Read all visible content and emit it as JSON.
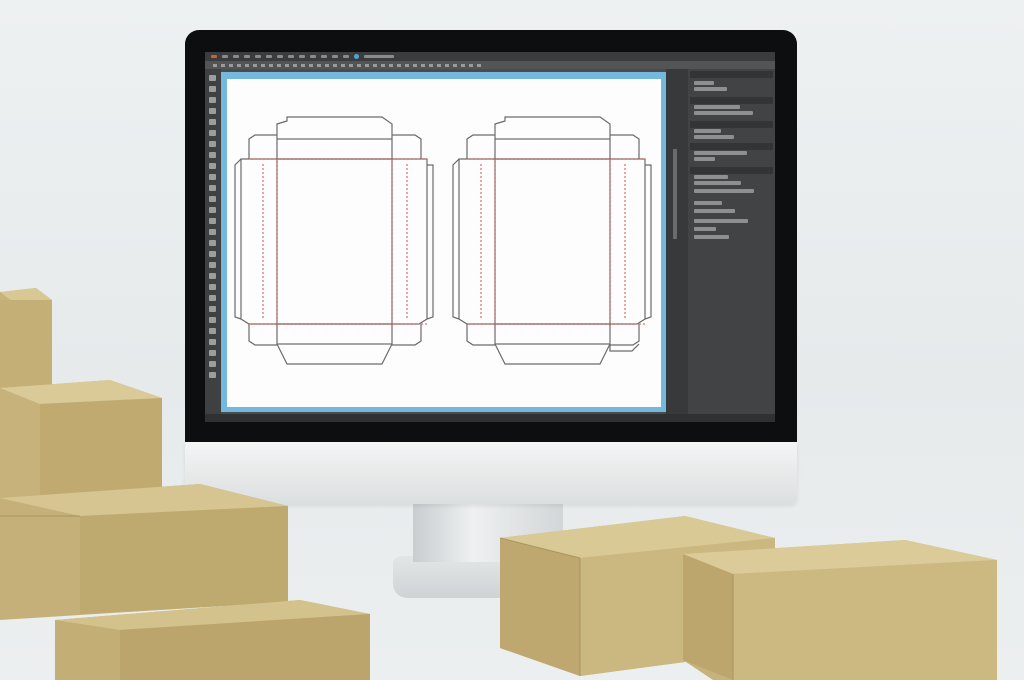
{
  "scene": {
    "description_tags": [
      "monitor-icon",
      "cardboard-box-icon"
    ],
    "colors": {
      "background": "#e9ecee",
      "bezel": "#0d0e10",
      "app_chrome": "#4a4b4d",
      "canvas_border": "#74b8de",
      "dieline_stroke": "#6b6b6b",
      "fold_line": "#e0504a",
      "cardboard": "#c9b37c"
    }
  }
}
